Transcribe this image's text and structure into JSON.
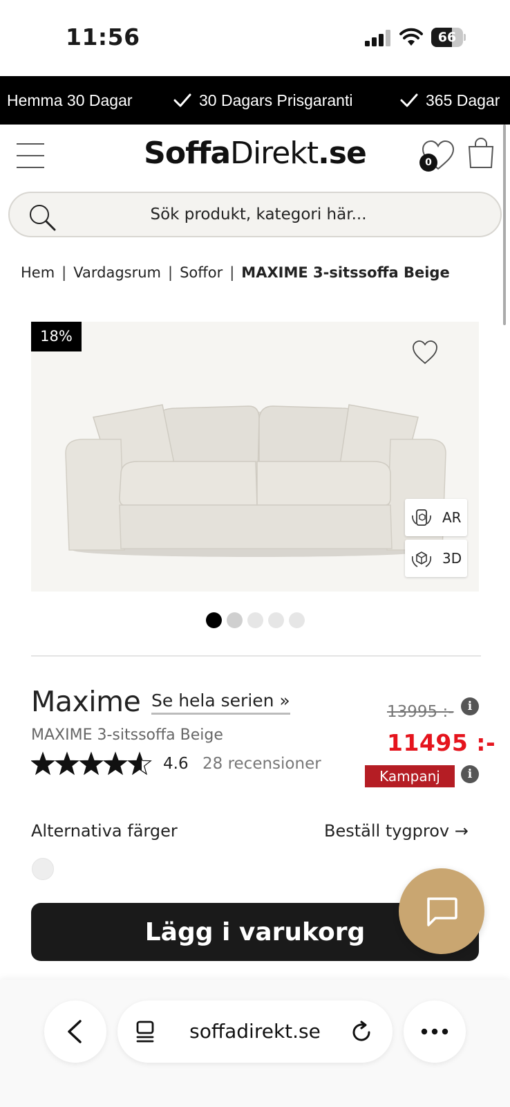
{
  "status_bar": {
    "time": "11:56",
    "battery": "66",
    "battery_fraction": 0.66
  },
  "promo": {
    "items": [
      "Hemma 30 Dagar",
      "30 Dagars Prisgaranti",
      "365 Dagar"
    ]
  },
  "header": {
    "logo_bold": "Soffa",
    "logo_regular": "Direkt",
    "logo_suffix": ".se",
    "wishlist_count": "0",
    "search_placeholder": "Sök produkt, kategori här..."
  },
  "breadcrumb": {
    "items": [
      "Hem",
      "Vardagsrum",
      "Soffor"
    ],
    "separator": "|",
    "current": "MAXIME 3-sitssoffa Beige"
  },
  "gallery": {
    "discount": "18%",
    "ar_label": "AR",
    "view3d_label": "3D",
    "dot_count": 5,
    "active_index": 0
  },
  "product": {
    "name": "Maxime",
    "series_link": "Se hela serien »",
    "subtitle": "MAXIME 3-sitssoffa Beige",
    "rating": "4.6",
    "rating_value": 4.6,
    "rating_max": 5,
    "reviews": "28 recensioner",
    "old_price": "13995 :-",
    "new_price": "11495 :-",
    "campaign": "Kampanj",
    "info_glyph": "i"
  },
  "options": {
    "alt_colors": "Alternativa färger",
    "fabric_sample": "Beställ tygprov →"
  },
  "actions": {
    "add_to_cart": "Lägg i varukorg"
  },
  "browser": {
    "url": "soffadirekt.se"
  },
  "colors": {
    "price_red": "#e5141d",
    "campaign_red": "#b51d24",
    "chat_gold": "#c9a671",
    "button_dark": "#1a1a1a"
  }
}
